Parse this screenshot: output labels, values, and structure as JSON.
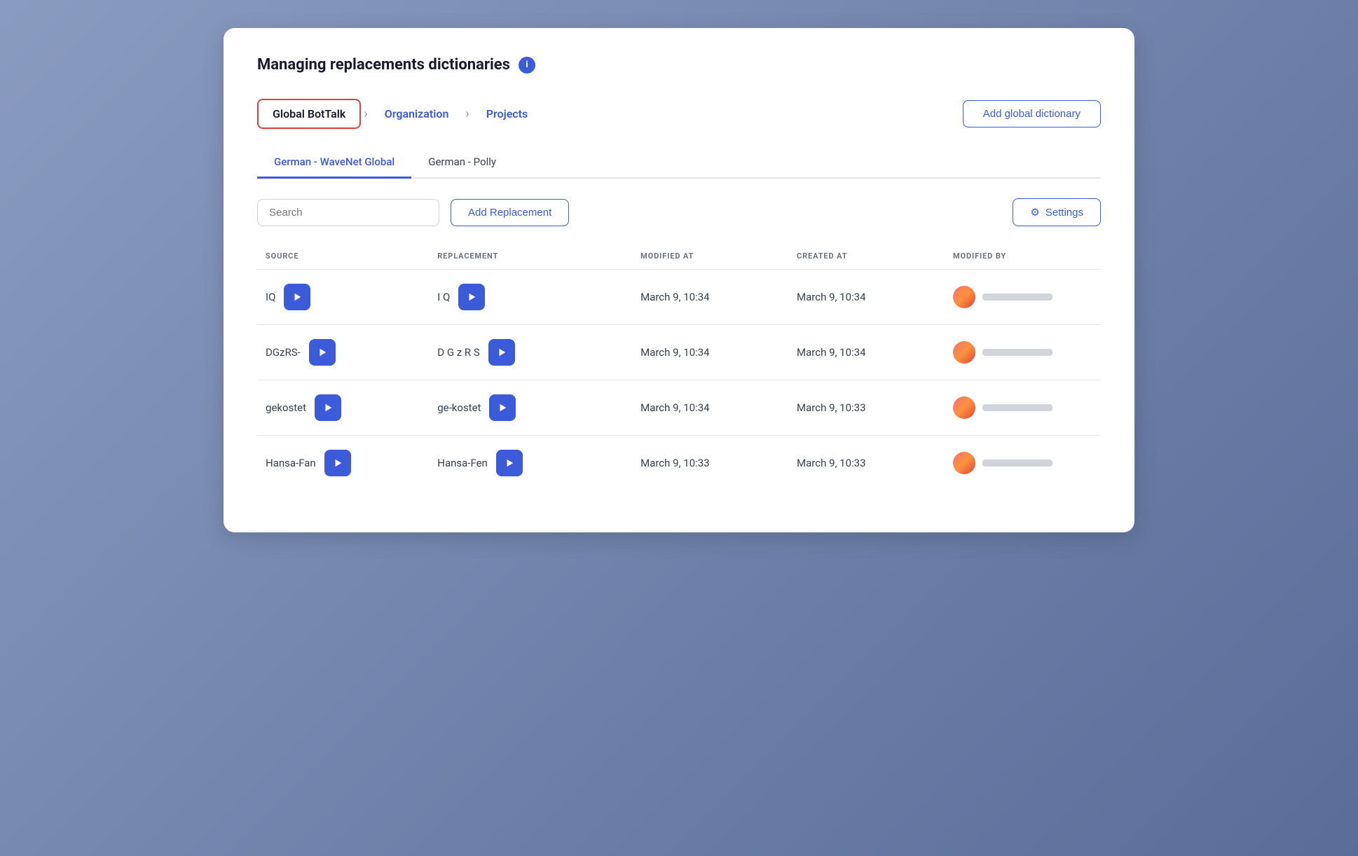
{
  "page": {
    "title": "Managing replacements dictionaries",
    "info_icon_label": "i"
  },
  "breadcrumb": {
    "items": [
      {
        "id": "global-bottalk",
        "label": "Global BotTalk",
        "active": true
      },
      {
        "id": "organization",
        "label": "Organization",
        "active": false
      },
      {
        "id": "projects",
        "label": "Projects",
        "active": false
      }
    ],
    "add_global_label": "Add global dictionary"
  },
  "tabs": [
    {
      "id": "tab-wavenet",
      "label": "German - WaveNet Global",
      "active": true
    },
    {
      "id": "tab-polly",
      "label": "German - Polly",
      "active": false
    }
  ],
  "toolbar": {
    "search_placeholder": "Search",
    "add_replacement_label": "Add Replacement",
    "settings_label": "Settings"
  },
  "table": {
    "columns": [
      {
        "id": "source",
        "label": "SOURCE"
      },
      {
        "id": "replacement",
        "label": "REPLACEMENT"
      },
      {
        "id": "modified_at",
        "label": "MODIFIED AT"
      },
      {
        "id": "created_at",
        "label": "CREATED AT"
      },
      {
        "id": "modified_by",
        "label": "MODIFIED BY"
      }
    ],
    "rows": [
      {
        "id": "row-1",
        "source": "IQ",
        "replacement": "I Q",
        "modified_at": "March 9, 10:34",
        "created_at": "March 9, 10:34"
      },
      {
        "id": "row-2",
        "source": "DGzRS-",
        "replacement": "D G z R S",
        "modified_at": "March 9, 10:34",
        "created_at": "March 9, 10:34"
      },
      {
        "id": "row-3",
        "source": "gekostet",
        "replacement": "ge-kostet",
        "modified_at": "March 9, 10:34",
        "created_at": "March 9, 10:33"
      },
      {
        "id": "row-4",
        "source": "Hansa-Fan",
        "replacement": "Hansa-Fen",
        "modified_at": "March 9, 10:33",
        "created_at": "March 9, 10:33"
      }
    ]
  }
}
